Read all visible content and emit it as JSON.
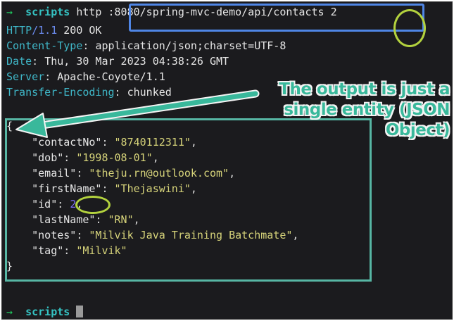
{
  "terminal": {
    "command": {
      "prompt_arrow": "→",
      "prompt_dir": "scripts",
      "program": "http",
      "url": ":8080/spring-mvc-demo/api/contacts",
      "arg": "2"
    },
    "response": {
      "protocol": "HTTP",
      "version": "/1.1",
      "status": "200 OK",
      "headers": [
        {
          "key": "Content-Type",
          "value": "application/json;charset=UTF-8"
        },
        {
          "key": "Date",
          "value": "Thu, 30 Mar 2023 04:38:26 GMT"
        },
        {
          "key": "Server",
          "value": "Apache-Coyote/1.1"
        },
        {
          "key": "Transfer-Encoding",
          "value": "chunked"
        }
      ],
      "body": {
        "open_brace": "{",
        "close_brace": "}",
        "fields": [
          {
            "key": "\"contactNo\"",
            "value": "\"8740112311\"",
            "kind": "string"
          },
          {
            "key": "\"dob\"",
            "value": "\"1998-08-01\"",
            "kind": "string"
          },
          {
            "key": "\"email\"",
            "value": "\"theju.rn@outlook.com\"",
            "kind": "string"
          },
          {
            "key": "\"firstName\"",
            "value": "\"Thejaswini\"",
            "kind": "string"
          },
          {
            "key": "\"id\"",
            "value": "2",
            "kind": "number"
          },
          {
            "key": "\"lastName\"",
            "value": "\"RN\"",
            "kind": "string"
          },
          {
            "key": "\"notes\"",
            "value": "\"Milvik Java Training Batchmate\"",
            "kind": "string"
          },
          {
            "key": "\"tag\"",
            "value": "\"Milvik\"",
            "kind": "string"
          }
        ]
      }
    },
    "next_prompt": {
      "prompt_arrow": "→",
      "prompt_dir": "scripts"
    }
  },
  "annotation": {
    "callout_lines": [
      "The output is just a",
      "single entity (JSON",
      "Object)"
    ]
  },
  "colors": {
    "terminal_bg": "#1b1b1e",
    "url_box": "#4f86e6",
    "highlight_circle": "#b3d23e",
    "json_box": "#57b6a4",
    "callout_text": "#39b89b"
  },
  "icons": {
    "cursor": "block-cursor-icon",
    "arrow": "callout-arrow-icon"
  }
}
